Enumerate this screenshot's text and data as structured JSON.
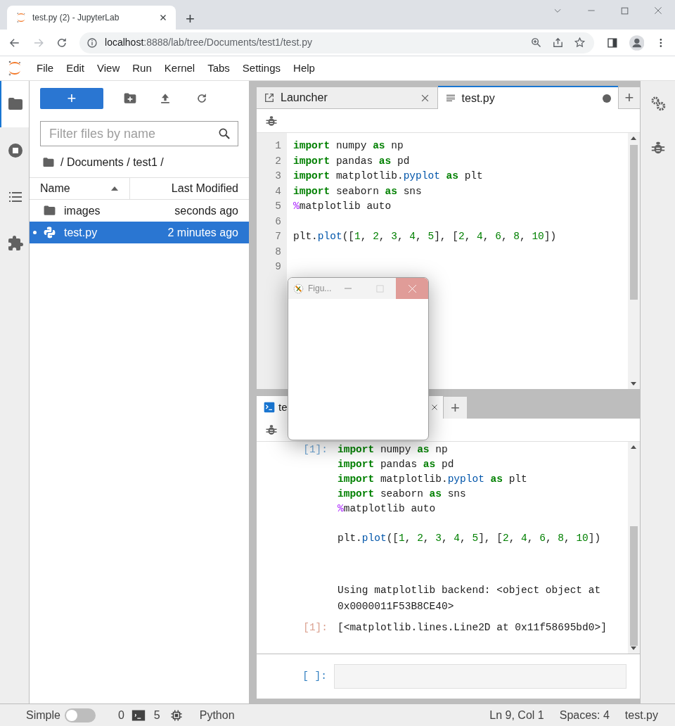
{
  "browser": {
    "tab_title": "test.py (2) - JupyterLab",
    "new_tab": "+",
    "url_host": "localhost",
    "url_rest": ":8888/lab/tree/Documents/test1/test.py"
  },
  "menu": [
    "File",
    "Edit",
    "View",
    "Run",
    "Kernel",
    "Tabs",
    "Settings",
    "Help"
  ],
  "activity_bar": [
    {
      "kind": "folder",
      "selected": true
    },
    {
      "kind": "running",
      "selected": false
    },
    {
      "kind": "toc",
      "selected": false
    },
    {
      "kind": "extensions",
      "selected": false
    }
  ],
  "file_browser": {
    "new_button": "+",
    "filter_placeholder": "Filter files by name",
    "breadcrumb": "/ Documents / test1 /",
    "columns": [
      "Name",
      "Last Modified"
    ],
    "files": [
      {
        "name": "images",
        "modified": "seconds ago",
        "kind": "folder",
        "selected": false
      },
      {
        "name": "test.py",
        "modified": "2 minutes ago",
        "kind": "python",
        "selected": true
      }
    ]
  },
  "editor": {
    "tabs": [
      {
        "label": "Launcher",
        "kind": "launcher",
        "selected": false,
        "modified": false
      },
      {
        "label": "test.py",
        "kind": "file",
        "selected": true,
        "modified": true
      }
    ],
    "add_tab": "+",
    "lines": [
      {
        "number": "1",
        "tokens": [
          {
            "t": "import",
            "kind": "kw"
          },
          {
            "t": " numpy ",
            "kind": "plain"
          },
          {
            "t": "as",
            "kind": "kw"
          },
          {
            "t": " np",
            "kind": "plain"
          }
        ]
      },
      {
        "number": "2",
        "tokens": [
          {
            "t": "import",
            "kind": "kw"
          },
          {
            "t": " pandas ",
            "kind": "plain"
          },
          {
            "t": "as",
            "kind": "kw"
          },
          {
            "t": " pd",
            "kind": "plain"
          }
        ]
      },
      {
        "number": "3",
        "tokens": [
          {
            "t": "import",
            "kind": "kw"
          },
          {
            "t": " matplotlib.",
            "kind": "plain"
          },
          {
            "t": "pyplot ",
            "kind": "prop"
          },
          {
            "t": "as",
            "kind": "kw"
          },
          {
            "t": " plt",
            "kind": "plain"
          }
        ]
      },
      {
        "number": "4",
        "tokens": [
          {
            "t": "import",
            "kind": "kw"
          },
          {
            "t": " seaborn ",
            "kind": "plain"
          },
          {
            "t": "as",
            "kind": "kw"
          },
          {
            "t": " sns",
            "kind": "plain"
          }
        ]
      },
      {
        "number": "5",
        "tokens": [
          {
            "t": "%",
            "kind": "magic"
          },
          {
            "t": "matplotlib auto",
            "kind": "plain"
          }
        ]
      },
      {
        "number": "6"
      },
      {
        "number": "7",
        "tokens": [
          {
            "t": "plt.",
            "kind": "plain"
          },
          {
            "t": "plot",
            "kind": "prop"
          },
          {
            "t": "([",
            "kind": "plain"
          },
          {
            "t": "1",
            "kind": "num"
          },
          {
            "t": ", ",
            "kind": "plain"
          },
          {
            "t": "2",
            "kind": "num"
          },
          {
            "t": ", ",
            "kind": "plain"
          },
          {
            "t": "3",
            "kind": "num"
          },
          {
            "t": ", ",
            "kind": "plain"
          },
          {
            "t": "4",
            "kind": "num"
          },
          {
            "t": ", ",
            "kind": "plain"
          },
          {
            "t": "5",
            "kind": "num"
          },
          {
            "t": "], [",
            "kind": "plain"
          },
          {
            "t": "2",
            "kind": "num"
          },
          {
            "t": ", ",
            "kind": "plain"
          },
          {
            "t": "4",
            "kind": "num"
          },
          {
            "t": ", ",
            "kind": "plain"
          },
          {
            "t": "6",
            "kind": "num"
          },
          {
            "t": ", ",
            "kind": "plain"
          },
          {
            "t": "8",
            "kind": "num"
          },
          {
            "t": ", ",
            "kind": "plain"
          },
          {
            "t": "10",
            "kind": "num"
          },
          {
            "t": "])",
            "kind": "plain"
          }
        ]
      },
      {
        "number": "8"
      },
      {
        "number": "9"
      }
    ]
  },
  "console": {
    "tab_label": "te",
    "add_tab": "+",
    "cells": [
      {
        "kind": "input",
        "prompt": "[1]:",
        "blocks": [
          {
            "lines": [
              {
                "tokens": [
                  {
                    "t": "import",
                    "kind": "kw"
                  },
                  {
                    "t": " numpy ",
                    "kind": "plain"
                  },
                  {
                    "t": "as",
                    "kind": "kw"
                  },
                  {
                    "t": " np",
                    "kind": "plain"
                  }
                ]
              },
              {
                "tokens": [
                  {
                    "t": "import",
                    "kind": "kw"
                  },
                  {
                    "t": " pandas ",
                    "kind": "plain"
                  },
                  {
                    "t": "as",
                    "kind": "kw"
                  },
                  {
                    "t": " pd",
                    "kind": "plain"
                  }
                ]
              },
              {
                "tokens": [
                  {
                    "t": "import",
                    "kind": "kw"
                  },
                  {
                    "t": " matplotlib.",
                    "kind": "plain"
                  },
                  {
                    "t": "pyplot ",
                    "kind": "prop"
                  },
                  {
                    "t": "as",
                    "kind": "kw"
                  },
                  {
                    "t": " plt",
                    "kind": "plain"
                  }
                ]
              },
              {
                "tokens": [
                  {
                    "t": "import",
                    "kind": "kw"
                  },
                  {
                    "t": " seaborn ",
                    "kind": "plain"
                  },
                  {
                    "t": "as",
                    "kind": "kw"
                  },
                  {
                    "t": " sns",
                    "kind": "plain"
                  }
                ]
              },
              {
                "tokens": [
                  {
                    "t": "%",
                    "kind": "magic"
                  },
                  {
                    "t": "matplotlib auto",
                    "kind": "plain"
                  }
                ]
              }
            ]
          },
          {
            "lines": [
              {
                "tokens": [
                  {
                    "t": "plt.",
                    "kind": "plain"
                  },
                  {
                    "t": "plot",
                    "kind": "prop"
                  },
                  {
                    "t": "([",
                    "kind": "plain"
                  },
                  {
                    "t": "1",
                    "kind": "num"
                  },
                  {
                    "t": ", ",
                    "kind": "plain"
                  },
                  {
                    "t": "2",
                    "kind": "num"
                  },
                  {
                    "t": ", ",
                    "kind": "plain"
                  },
                  {
                    "t": "3",
                    "kind": "num"
                  },
                  {
                    "t": ", ",
                    "kind": "plain"
                  },
                  {
                    "t": "4",
                    "kind": "num"
                  },
                  {
                    "t": ", ",
                    "kind": "plain"
                  },
                  {
                    "t": "5",
                    "kind": "num"
                  },
                  {
                    "t": "], [",
                    "kind": "plain"
                  },
                  {
                    "t": "2",
                    "kind": "num"
                  },
                  {
                    "t": ", ",
                    "kind": "plain"
                  },
                  {
                    "t": "4",
                    "kind": "num"
                  },
                  {
                    "t": ", ",
                    "kind": "plain"
                  },
                  {
                    "t": "6",
                    "kind": "num"
                  },
                  {
                    "t": ", ",
                    "kind": "plain"
                  },
                  {
                    "t": "8",
                    "kind": "num"
                  },
                  {
                    "t": ", ",
                    "kind": "plain"
                  },
                  {
                    "t": "10",
                    "kind": "num"
                  },
                  {
                    "t": "])",
                    "kind": "plain"
                  }
                ]
              }
            ]
          }
        ]
      },
      {
        "kind": "stdout",
        "text": "Using matplotlib backend: <object object at 0x0000011F53B8CE40>"
      },
      {
        "kind": "output",
        "prompt": "[1]:",
        "text": "[<matplotlib.lines.Line2D at 0x11f58695bd0>]"
      }
    ],
    "input_prompt": "[ ]:"
  },
  "figure_window": {
    "title": "Figu..."
  },
  "status_bar": {
    "mode_label": "Simple",
    "simple_mode": false,
    "terminals": "0",
    "kernels": "5",
    "kernel": "Python",
    "position": "Ln 9, Col 1",
    "indent": "Spaces: 4",
    "file": "test.py"
  }
}
